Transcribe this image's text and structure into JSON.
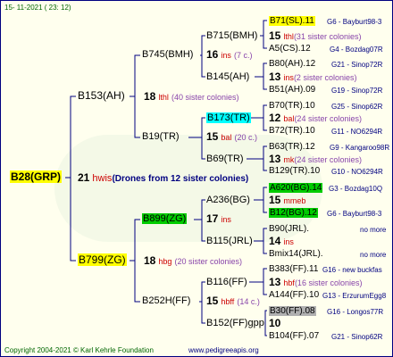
{
  "header": {
    "date": "15- 11-2021 ( 23: 12)"
  },
  "footer": {
    "copyright": "Copyright 2004-2021 © Karl Kehrle Foundation",
    "site": "www.pedigreeapis.org"
  },
  "colors": {
    "line": "#000080",
    "background": "#ffffee",
    "highlight_yellow": "#ffff00",
    "highlight_cyan": "#00ffff",
    "highlight_green": "#00cc00",
    "highlight_grey": "#b0b0b0"
  },
  "root": {
    "name": "B28(GRP)",
    "count": "21",
    "ins": "hwis",
    "note": "(Drones from 12 sister colonies)"
  },
  "g1": [
    {
      "name": "B153(AH)",
      "count": "18",
      "ins": "lthl",
      "note": "(40 sister colonies)"
    },
    {
      "name": "B799(ZG)",
      "count": "18",
      "ins": "hbg",
      "note": "(20 sister colonies)"
    }
  ],
  "g2": [
    {
      "name": "B745(BMH)",
      "count": "16",
      "ins": "ins",
      "note": "(7 c.)"
    },
    {
      "name": "B19(TR)",
      "count": "15",
      "ins": "bal",
      "note": "(20 c.)"
    },
    {
      "name": "B899(ZG)",
      "count": "17",
      "ins": "ins",
      "note": ""
    },
    {
      "name": "B252H(FF)",
      "count": "15",
      "ins": "hbff",
      "note": "(14 c.)"
    }
  ],
  "g3": [
    {
      "name": "B715(BMH)",
      "count": "15",
      "ins": "lthl",
      "note": "(31 sister colonies)"
    },
    {
      "name": "B145(AH)",
      "count": "13",
      "ins": "ins",
      "note": "(2 sister colonies)"
    },
    {
      "name": "B173(TR)",
      "count": "12",
      "ins": "bal",
      "note": "(24 sister colonies)"
    },
    {
      "name": "B69(TR)",
      "count": "13",
      "ins": "mk",
      "note": "(24 sister colonies)"
    },
    {
      "name": "A236(BG)",
      "count": "15",
      "ins": "mmeb",
      "note": ""
    },
    {
      "name": "B115(JRL)",
      "count": "14",
      "ins": "ins",
      "note": ""
    },
    {
      "name": "B116(FF)",
      "count": "13",
      "ins": "hbf",
      "note": "(16 sister colonies)"
    },
    {
      "name": "B152(FF)gpp",
      "count": "10",
      "ins": "",
      "note": ""
    }
  ],
  "g4": [
    {
      "name": "B71(SL).11",
      "ped": "G6 - Bayburt98-3"
    },
    {
      "name": "A5(CS).12",
      "ped": "G4 - Bozdag07R"
    },
    {
      "name": "B80(AH).12",
      "ped": "G21 - Sinop72R"
    },
    {
      "name": "B51(AH).09",
      "ped": "G19 - Sinop72R"
    },
    {
      "name": "B70(TR).10",
      "ped": "G25 - Sinop62R"
    },
    {
      "name": "B72(TR).10",
      "ped": "G11 - NO6294R"
    },
    {
      "name": "B63(TR).12",
      "ped": "G9 - Kangaroo98R"
    },
    {
      "name": "B129(TR).10",
      "ped": "G10 - NO6294R"
    },
    {
      "name": "A620(BG).14",
      "ped": "G3 - Bozdag10Q"
    },
    {
      "name": "B12(BG).12",
      "ped": "G6 - Bayburt98-3"
    },
    {
      "name": "B90(JRL).",
      "ped": "no more"
    },
    {
      "name": "Bmix14(JRL).",
      "ped": "no more"
    },
    {
      "name": "B383(FF).11",
      "ped": "G16 - new buckfas"
    },
    {
      "name": "A144(FF).10",
      "ped": "G13 - ErzurumEgg8"
    },
    {
      "name": "B30(FF).08",
      "ped": "G16 - Longos77R"
    },
    {
      "name": "B104(FF).07",
      "ped": "G21 - Sinop62R"
    }
  ]
}
